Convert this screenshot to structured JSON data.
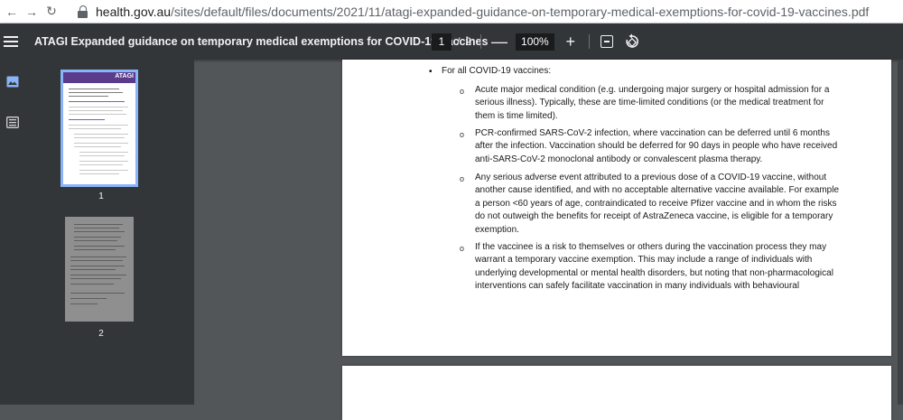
{
  "browser": {
    "url_domain": "health.gov.au",
    "url_path": "/sites/default/files/documents/2021/11/atagi-expanded-guidance-on-temporary-medical-exemptions-for-covid-19-vaccines.pdf"
  },
  "toolbar": {
    "title": "ATAGI Expanded guidance on temporary medical exemptions for COVID-19 vaccines",
    "current_page": "1",
    "separator": "/",
    "total_pages": "2",
    "zoom": "100%",
    "zoom_out": "—",
    "zoom_in": "+"
  },
  "thumbnails": [
    {
      "label": "1",
      "badge": "ATAGI"
    },
    {
      "label": "2"
    }
  ],
  "document": {
    "main_bullet": "For all COVID-19 vaccines:",
    "items": [
      {
        "lines": [
          "Acute major medical condition (e.g. undergoing major surgery or hospital admission for a",
          "serious illness). Typically, these are time-limited conditions (or the medical treatment for",
          "them is time limited)."
        ]
      },
      {
        "lines": [
          "PCR-confirmed SARS-CoV-2 infection, where vaccination can be deferred until 6 months",
          "after the infection. Vaccination should be deferred for 90 days in people who have received",
          "anti-SARS-CoV-2 monoclonal antibody or convalescent plasma therapy."
        ]
      },
      {
        "lines": [
          "Any serious adverse event attributed to a previous dose of a COVID-19 vaccine, without",
          "another cause identified, and with no acceptable alternative vaccine available. For example",
          "a person <60 years of age, contraindicated to receive Pfizer vaccine and in whom the risks",
          "do not outweigh the benefits for receipt of AstraZeneca vaccine, is eligible for a temporary",
          "exemption."
        ]
      },
      {
        "lines": [
          "If the vaccinee is a risk to themselves or others during the vaccination process they may",
          "warrant a temporary vaccine exemption. This may include a range of individuals with",
          "underlying developmental or mental health disorders, but noting that non-pharmacological",
          "interventions can safely facilitate vaccination in many individuals with behavioural"
        ]
      }
    ],
    "bullet_main_glyph": "•",
    "bullet_sub_glyph": "o"
  },
  "colors": {
    "toolbar_bg": "#323639",
    "viewer_bg": "#525659",
    "highlight_arrow": "#ffff00",
    "thumb_selected": "#8ab4f8"
  }
}
